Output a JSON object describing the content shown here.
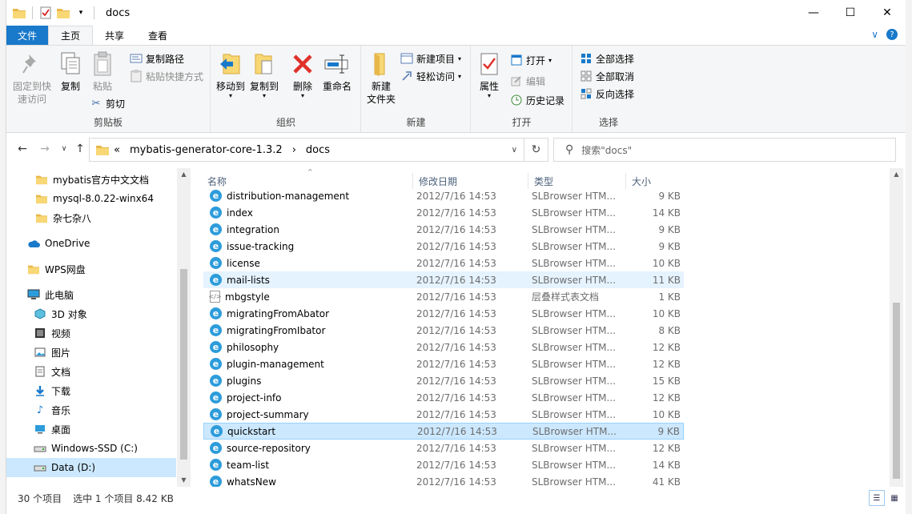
{
  "window": {
    "title": "docs",
    "controls": {
      "minimize": "—",
      "maximize": "☐",
      "close": "✕"
    }
  },
  "tabs": [
    "文件",
    "主页",
    "共享",
    "查看"
  ],
  "ribbon": {
    "clipboard": {
      "label": "剪贴板",
      "pin_quick_access": "固定到快速访问",
      "pin_line1": "固定到快",
      "pin_line2": "速访问",
      "copy": "复制",
      "paste": "粘贴",
      "copy_path": "复制路径",
      "paste_shortcut": "粘贴快捷方式",
      "cut": "剪切"
    },
    "organize": {
      "label": "组织",
      "move_to": "移动到",
      "copy_to": "复制到",
      "delete": "删除",
      "rename": "重命名"
    },
    "new": {
      "label": "新建",
      "new_folder_line1": "新建",
      "new_folder_line2": "文件夹",
      "new_item": "新建项目",
      "easy_access": "轻松访问"
    },
    "open": {
      "label": "打开",
      "properties": "属性",
      "open": "打开",
      "edit": "编辑",
      "history": "历史记录"
    },
    "select": {
      "label": "选择",
      "select_all": "全部选择",
      "select_none": "全部取消",
      "invert": "反向选择"
    }
  },
  "address": {
    "prefix": "«",
    "path": [
      "mybatis-generator-core-1.3.2",
      "docs"
    ],
    "sep": "›"
  },
  "search": {
    "placeholder": "搜索\"docs\""
  },
  "nav": {
    "items": [
      {
        "label": "mybatis官方中文文档",
        "icon": "folder-icon"
      },
      {
        "label": "mysql-8.0.22-winx64",
        "icon": "folder-icon"
      },
      {
        "label": "杂七杂八",
        "icon": "folder-icon"
      },
      {
        "label": "OneDrive",
        "icon": "cloud-icon"
      },
      {
        "label": "WPS网盘",
        "icon": "folder-icon"
      },
      {
        "label": "此电脑",
        "icon": "computer-icon"
      },
      {
        "label": "3D 对象",
        "icon": "cube-icon"
      },
      {
        "label": "视频",
        "icon": "video-icon"
      },
      {
        "label": "图片",
        "icon": "picture-icon"
      },
      {
        "label": "文档",
        "icon": "document-icon"
      },
      {
        "label": "下载",
        "icon": "download-icon"
      },
      {
        "label": "音乐",
        "icon": "music-icon"
      },
      {
        "label": "桌面",
        "icon": "desktop-icon"
      },
      {
        "label": "Windows-SSD (C:)",
        "icon": "drive-icon"
      },
      {
        "label": "Data (D:)",
        "icon": "drive-icon"
      }
    ]
  },
  "columns": {
    "name": "名称",
    "date": "修改日期",
    "type": "类型",
    "size": "大小"
  },
  "files": [
    {
      "name": "distribution-management",
      "date": "2012/7/16 14:53",
      "type": "SLBrowser HTM...",
      "size": "9 KB",
      "icon": "e"
    },
    {
      "name": "index",
      "date": "2012/7/16 14:53",
      "type": "SLBrowser HTM...",
      "size": "14 KB",
      "icon": "e"
    },
    {
      "name": "integration",
      "date": "2012/7/16 14:53",
      "type": "SLBrowser HTM...",
      "size": "9 KB",
      "icon": "e"
    },
    {
      "name": "issue-tracking",
      "date": "2012/7/16 14:53",
      "type": "SLBrowser HTM...",
      "size": "9 KB",
      "icon": "e"
    },
    {
      "name": "license",
      "date": "2012/7/16 14:53",
      "type": "SLBrowser HTM...",
      "size": "10 KB",
      "icon": "e"
    },
    {
      "name": "mail-lists",
      "date": "2012/7/16 14:53",
      "type": "SLBrowser HTM...",
      "size": "11 KB",
      "icon": "e"
    },
    {
      "name": "mbgstyle",
      "date": "2012/7/16 14:53",
      "type": "层叠样式表文档",
      "size": "1 KB",
      "icon": "css"
    },
    {
      "name": "migratingFromAbator",
      "date": "2012/7/16 14:53",
      "type": "SLBrowser HTM...",
      "size": "10 KB",
      "icon": "e"
    },
    {
      "name": "migratingFromIbator",
      "date": "2012/7/16 14:53",
      "type": "SLBrowser HTM...",
      "size": "8 KB",
      "icon": "e"
    },
    {
      "name": "philosophy",
      "date": "2012/7/16 14:53",
      "type": "SLBrowser HTM...",
      "size": "12 KB",
      "icon": "e"
    },
    {
      "name": "plugin-management",
      "date": "2012/7/16 14:53",
      "type": "SLBrowser HTM...",
      "size": "12 KB",
      "icon": "e"
    },
    {
      "name": "plugins",
      "date": "2012/7/16 14:53",
      "type": "SLBrowser HTM...",
      "size": "15 KB",
      "icon": "e"
    },
    {
      "name": "project-info",
      "date": "2012/7/16 14:53",
      "type": "SLBrowser HTM...",
      "size": "12 KB",
      "icon": "e"
    },
    {
      "name": "project-summary",
      "date": "2012/7/16 14:53",
      "type": "SLBrowser HTM...",
      "size": "10 KB",
      "icon": "e"
    },
    {
      "name": "quickstart",
      "date": "2012/7/16 14:53",
      "type": "SLBrowser HTM...",
      "size": "9 KB",
      "icon": "e"
    },
    {
      "name": "source-repository",
      "date": "2012/7/16 14:53",
      "type": "SLBrowser HTM...",
      "size": "12 KB",
      "icon": "e"
    },
    {
      "name": "team-list",
      "date": "2012/7/16 14:53",
      "type": "SLBrowser HTM...",
      "size": "14 KB",
      "icon": "e"
    },
    {
      "name": "whatsNew",
      "date": "2012/7/16 14:53",
      "type": "SLBrowser HTM...",
      "size": "41 KB",
      "icon": "e"
    }
  ],
  "hovered_file": "mail-lists",
  "selected_file": "quickstart",
  "status": {
    "count": "30 个项目",
    "selection": "选中 1 个项目  8.42 KB"
  },
  "colors": {
    "accent": "#1979ca",
    "selection": "#cce8ff",
    "hover": "#e5f3ff"
  }
}
